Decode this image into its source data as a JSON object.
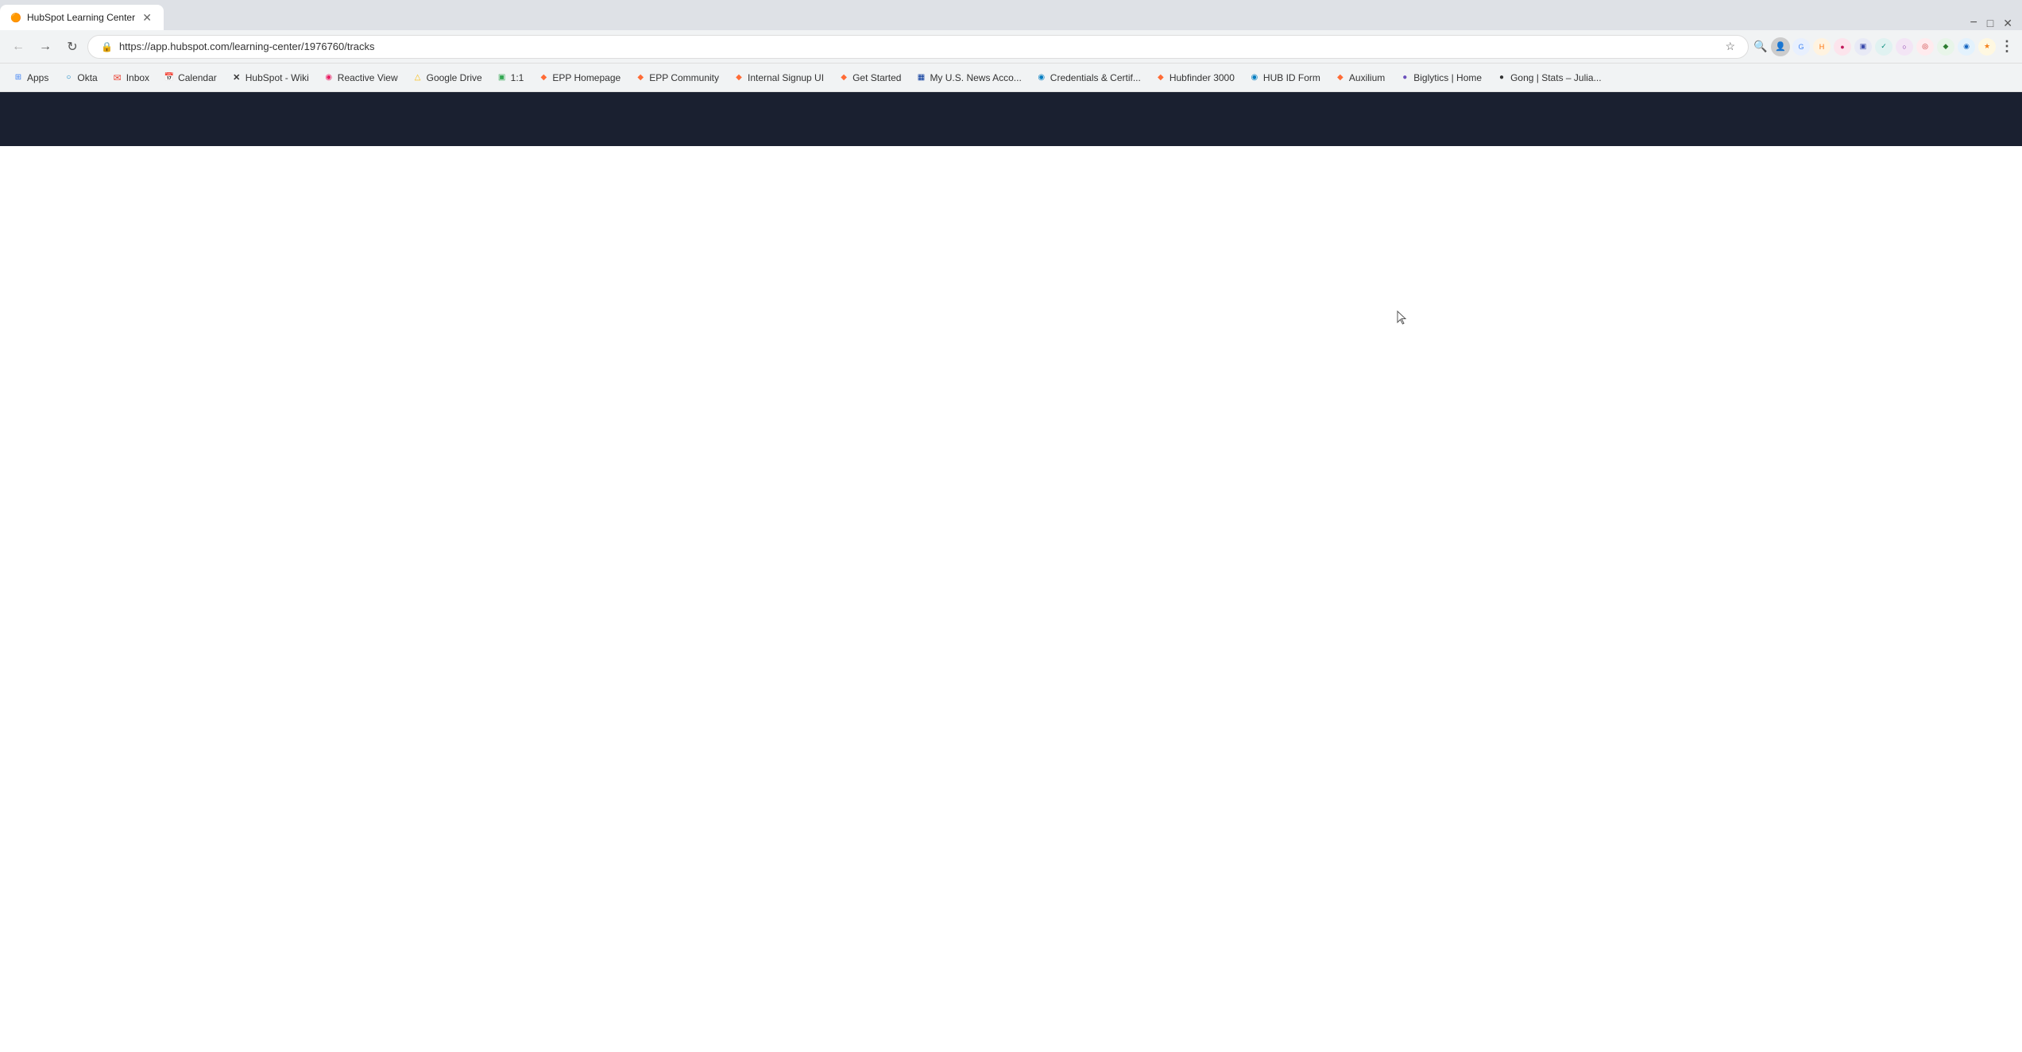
{
  "browser": {
    "url": "https://app.hubspot.com/learning-center/1976760/tracks",
    "back_btn": "←",
    "forward_btn": "→",
    "reload_btn": "↻",
    "tab_title": "HubSpot Learning Center",
    "tab_favicon": "🟠"
  },
  "bookmarks": [
    {
      "label": "Apps",
      "favicon": "⊞",
      "color": "#4285f4"
    },
    {
      "label": "Okta",
      "favicon": "○",
      "color": "#007dc1"
    },
    {
      "label": "Inbox",
      "favicon": "✉",
      "color": "#ea4335"
    },
    {
      "label": "Calendar",
      "favicon": "📅",
      "color": "#4285f4"
    },
    {
      "label": "HubSpot - Wiki",
      "favicon": "✕",
      "color": "#333"
    },
    {
      "label": "Reactive View",
      "favicon": "◉",
      "color": "#e91e63"
    },
    {
      "label": "Google Drive",
      "favicon": "△",
      "color": "#fbbc04"
    },
    {
      "label": "1:1",
      "favicon": "▣",
      "color": "#34a853"
    },
    {
      "label": "EPP Homepage",
      "favicon": "◆",
      "color": "#ff6b35"
    },
    {
      "label": "EPP Community",
      "favicon": "◆",
      "color": "#ff6b35"
    },
    {
      "label": "Internal Signup UI",
      "favicon": "◆",
      "color": "#ff6b35"
    },
    {
      "label": "Get Started",
      "favicon": "◆",
      "color": "#ff6b35"
    },
    {
      "label": "My U.S. News Acco...",
      "favicon": "▦",
      "color": "#003399"
    },
    {
      "label": "Credentials & Certif...",
      "favicon": "◉",
      "color": "#007dc1"
    },
    {
      "label": "Hubfinder 3000",
      "favicon": "◆",
      "color": "#ff6b35"
    },
    {
      "label": "HUB ID Form",
      "favicon": "◉",
      "color": "#007dc1"
    },
    {
      "label": "Auxilium",
      "favicon": "◆",
      "color": "#ff6b35"
    },
    {
      "label": "Biglytics | Home",
      "favicon": "●",
      "color": "#6b4fbb"
    },
    {
      "label": "Gong | Stats – Julia...",
      "favicon": "●",
      "color": "#333"
    }
  ],
  "nav_icons": {
    "search": "🔍",
    "star": "☆",
    "account": "👤",
    "extensions": "⚙",
    "dots": "⋮"
  },
  "header": {
    "background": "#1a2030"
  },
  "main": {
    "background": "#ffffff"
  }
}
